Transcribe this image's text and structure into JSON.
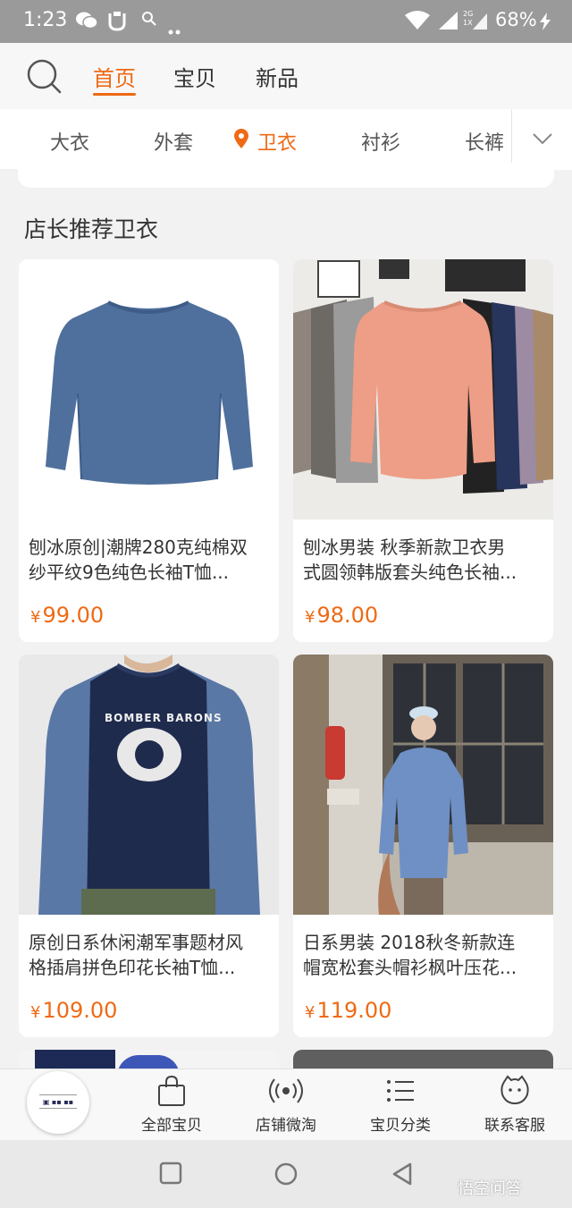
{
  "status_bar": {
    "time": "1:23",
    "battery": "68%",
    "signal_tag_top": "2G",
    "signal_tag_bottom": "1X",
    "icons": [
      "wechat-icon",
      "notification-icon",
      "search-icon",
      "more-dots-icon",
      "wifi-icon",
      "signal-icon",
      "charging-icon"
    ]
  },
  "top_nav": {
    "tabs": [
      {
        "label": "首页",
        "active": true
      },
      {
        "label": "宝贝",
        "active": false
      },
      {
        "label": "新品",
        "active": false
      }
    ]
  },
  "categories": [
    {
      "label": "大衣",
      "active": false
    },
    {
      "label": "外套",
      "active": false
    },
    {
      "label": "卫衣",
      "active": true
    },
    {
      "label": "衬衫",
      "active": false
    },
    {
      "label": "长裤",
      "active": false
    }
  ],
  "section_title": "店长推荐卫衣",
  "products": [
    {
      "title_line1": "刨冰原创|潮牌280克纯棉双",
      "title_line2": "纱平纹9色纯色长袖T恤...",
      "currency": "¥",
      "price": "99.00"
    },
    {
      "title_line1": "刨冰男装 秋季新款卫衣男",
      "title_line2": "式圆领韩版套头纯色长袖...",
      "currency": "¥",
      "price": "98.00"
    },
    {
      "title_line1": "原创日系休闲潮军事题材风",
      "title_line2": "格插肩拼色印花长袖T恤...",
      "currency": "¥",
      "price": "109.00",
      "shirt_print_line1": "BOMBER BARONS"
    },
    {
      "title_line1": "日系男装 2018秋冬新款连",
      "title_line2": "帽宽松套头帽衫枫叶压花...",
      "currency": "¥",
      "price": "119.00"
    }
  ],
  "bottom_bar": {
    "items": [
      {
        "label": "全部宝贝",
        "icon": "shopping-bag-icon"
      },
      {
        "label": "店铺微淘",
        "icon": "broadcast-icon"
      },
      {
        "label": "宝贝分类",
        "icon": "list-icon"
      },
      {
        "label": "联系客服",
        "icon": "chat-face-icon"
      }
    ]
  },
  "watermark": "悟空问答",
  "colors": {
    "accent": "#ee6a15",
    "status_bar": "#9a9a9a",
    "page_bg": "#f2f2f2"
  }
}
